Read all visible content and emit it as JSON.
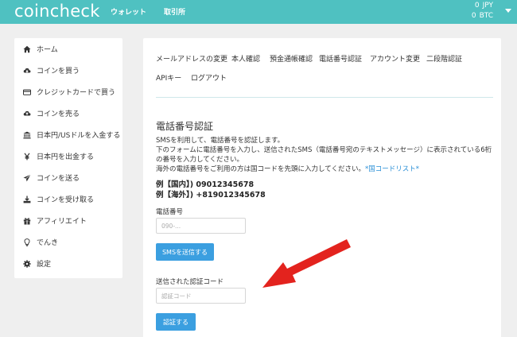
{
  "header": {
    "logo": "coincheck",
    "nav": [
      "ウォレット",
      "取引所"
    ],
    "balances": [
      {
        "amount": "0",
        "currency": "JPY"
      },
      {
        "amount": "0",
        "currency": "BTC"
      }
    ]
  },
  "sidebar": {
    "items": [
      {
        "label": "ホーム",
        "icon": "home-icon"
      },
      {
        "label": "コインを買う",
        "icon": "cloud-download-icon"
      },
      {
        "label": "クレジットカードで買う",
        "icon": "credit-card-icon"
      },
      {
        "label": "コインを売る",
        "icon": "cloud-upload-icon"
      },
      {
        "label": "日本円/USドルを入金する",
        "icon": "bank-icon"
      },
      {
        "label": "日本円を出金する",
        "icon": "yen-icon"
      },
      {
        "label": "コインを送る",
        "icon": "send-icon"
      },
      {
        "label": "コインを受け取る",
        "icon": "download-icon"
      },
      {
        "label": "アフィリエイト",
        "icon": "gift-icon"
      },
      {
        "label": "でんき",
        "icon": "lightbulb-icon"
      },
      {
        "label": "設定",
        "icon": "gear-icon"
      }
    ]
  },
  "tabs": [
    "メールアドレスの変更",
    "本人確認",
    "預金通帳確認",
    "電話番号認証",
    "アカウント変更",
    "二段階認証",
    "APIキー",
    "ログアウト"
  ],
  "phone": {
    "title": "電話番号認証",
    "desc1": "SMSを利用して、電話番号を認証します。",
    "desc2": "下のフォームに電話番号を入力し、送信されたSMS（電話番号宛のテキストメッセージ）に表示されている6桁",
    "desc3": "の番号を入力してください。",
    "desc4": "海外の電話番号をご利用の方は国コードを先頭に入力してください。",
    "link": "*国コードリスト*",
    "example_domestic": "例【国内】) 09012345678",
    "example_overseas": "例【海外】) +819012345678",
    "phone_label": "電話番号",
    "phone_placeholder": "090-...",
    "send_button": "SMSを送信する",
    "code_label": "送信された認証コード",
    "code_placeholder": "認証コード",
    "verify_button": "認証する"
  },
  "colors": {
    "header": "#4fc1c1",
    "button": "#3b9fe0",
    "arrow": "#e3231e",
    "link": "#2a8fd6"
  }
}
